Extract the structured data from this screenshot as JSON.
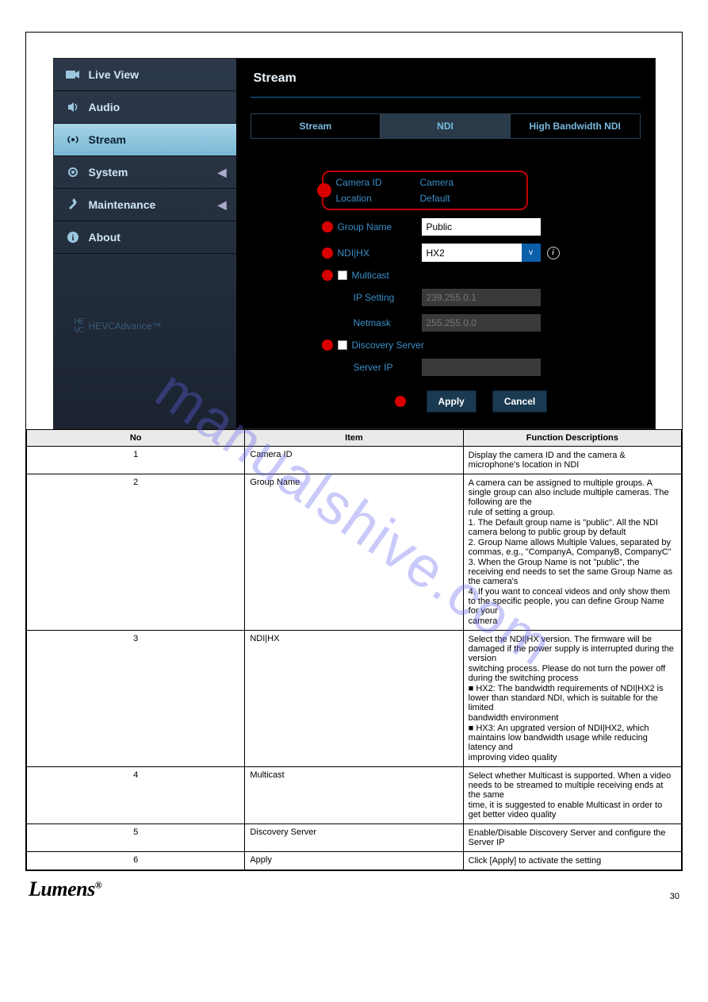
{
  "sidebar": {
    "items": [
      {
        "label": "Live View",
        "icon": "camera-icon"
      },
      {
        "label": "Audio",
        "icon": "speaker-icon"
      },
      {
        "label": "Stream",
        "icon": "signal-icon"
      },
      {
        "label": "System",
        "icon": "gear-icon"
      },
      {
        "label": "Maintenance",
        "icon": "wrench-icon"
      },
      {
        "label": "About",
        "icon": "info-icon"
      }
    ],
    "hevc_label": "HEVCAdvance™"
  },
  "main": {
    "title": "Stream",
    "tabs": [
      "Stream",
      "NDI",
      "High Bandwidth NDI"
    ],
    "form": {
      "camera_id_label": "Camera ID",
      "camera_id_value": "Camera",
      "location_label": "Location",
      "location_value": "Default",
      "group_name_label": "Group Name",
      "group_name_value": "Public",
      "ndihx_label": "NDI|HX",
      "ndihx_value": "HX2",
      "multicast_label": "Multicast",
      "ip_setting_label": "IP Setting",
      "ip_setting_value": "239.255.0.1",
      "netmask_label": "Netmask",
      "netmask_value": "255.255.0.0",
      "discovery_label": "Discovery Server",
      "server_ip_label": "Server IP",
      "server_ip_value": "",
      "apply_label": "Apply",
      "cancel_label": "Cancel"
    }
  },
  "watermark": "manualshive.com",
  "table": {
    "headers": [
      "No",
      "Item",
      "Function Descriptions"
    ],
    "rows": [
      {
        "no": "1",
        "item": "Camera ID",
        "desc": [
          "Display the camera ID and the camera & microphone's location in NDI"
        ]
      },
      {
        "no": "2",
        "item": "Group Name",
        "desc": [
          "A camera can be assigned to multiple groups. A single group can also include multiple cameras. The following are the",
          "rule of setting a group.",
          "1. The Default group name is \"public\". All the NDI camera belong to public group by default",
          "2. Group Name allows Multiple Values, separated by commas, e.g., \"CompanyA, CompanyB, CompanyC\"",
          "3. When the Group Name is not \"public\", the receiving end needs to set the same Group Name as the camera's",
          "4. If you want to conceal videos and only show them to the specific people, you can define Group Name for your",
          "camera"
        ]
      },
      {
        "no": "3",
        "item": "NDI|HX",
        "desc": [
          "Select the NDI|HX version. The firmware will be damaged if the power supply is interrupted during the version",
          "switching process. Please do not turn the power off during the switching process",
          "■ HX2: The bandwidth requirements of NDI|HX2 is lower than standard NDI, which is suitable for the limited",
          "bandwidth environment",
          "■ HX3: An upgrated version of NDI|HX2, which maintains low bandwidth usage while reducing latency and",
          "improving video quality"
        ]
      },
      {
        "no": "4",
        "item": "Multicast",
        "desc": [
          "Select whether Multicast is supported. When a video needs to be streamed to multiple receiving ends at the same",
          "time, it is suggested to enable Multicast in order to get better video quality"
        ]
      },
      {
        "no": "5",
        "item": "Discovery Server",
        "desc": [
          "Enable/Disable Discovery Server and configure the Server IP"
        ]
      },
      {
        "no": "6",
        "item": "Apply",
        "desc": [
          "Click [Apply] to activate the setting"
        ]
      }
    ]
  },
  "footer": {
    "brand": "Lumens",
    "reg": "®",
    "page_no": "30"
  }
}
